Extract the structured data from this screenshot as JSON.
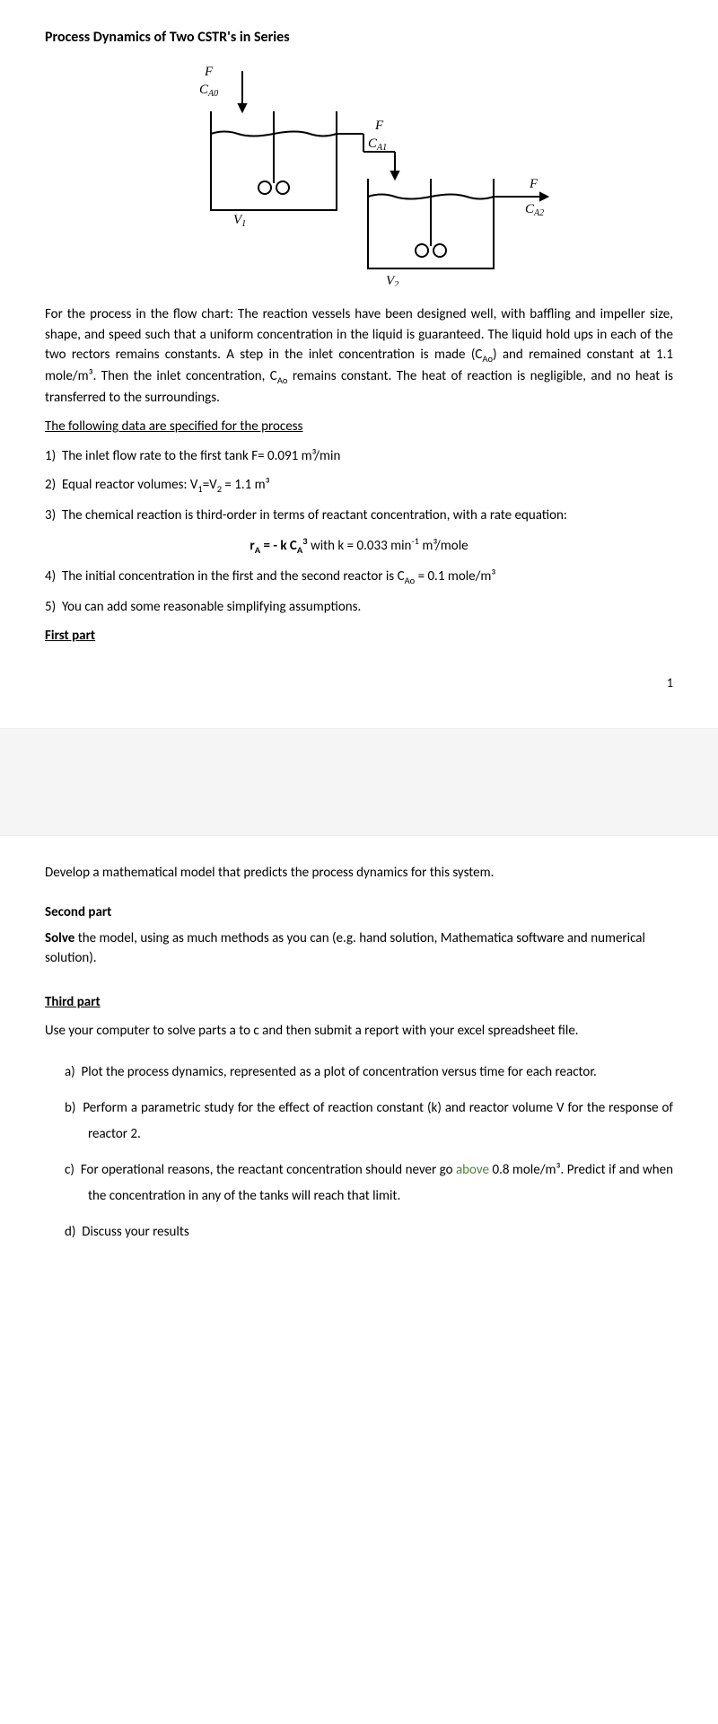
{
  "title": "Process Dynamics of Two CSTR's in Series",
  "diagram": {
    "inlet_F": "F",
    "inlet_C": "C",
    "inlet_C_sub": "A0",
    "tank1_V": "V",
    "tank1_V_sub": "1",
    "mid_F": "F",
    "mid_C": "C",
    "mid_C_sub": "A1",
    "tank2_V": "V",
    "tank2_V_sub": "2",
    "out_F": "F",
    "out_C": "C",
    "out_C_sub": "A2"
  },
  "intro_a": "For the process in the flow chart: The reaction vessels have been designed well, with baffling and impeller size, shape, and speed such that a uniform concentration in the liquid is guaranteed. The liquid hold ups in each of the two rectors remains constants. A step in the inlet concentration is made (C",
  "intro_a_sub": "Ao",
  "intro_b": ") and remained constant at 1.1 mole/m³. Then the inlet concentration, C",
  "intro_b_sub": "Ao",
  "intro_c": " remains constant. The heat of reaction is negligible, and no heat is transferred to the surroundings.",
  "spec_heading": "The following data are specified for the process",
  "spec": {
    "i1_n": "1)",
    "i1": "The inlet flow rate to the first tank F= 0.091 m³/min",
    "i2_n": "2)",
    "i2_a": "Equal reactor volumes: V",
    "i2_s1": "1",
    "i2_b": "=V",
    "i2_s2": "2",
    "i2_c": " = 1.1 m³",
    "i3_n": "3)",
    "i3": "The chemical reaction is third-order in terms of reactant concentration, with a rate equation:",
    "eq_a": "r",
    "eq_as": "A",
    "eq_b": " = - k C",
    "eq_bs": "A",
    "eq_bsup": "3",
    "eq_c": "  with k = 0.033 min",
    "eq_csup": "-1",
    "eq_d": " m³/mole",
    "i4_n": "4)",
    "i4_a": "The initial concentration in the first and the second reactor is C",
    "i4_s": "Ao",
    "i4_b": " = 0.1 mole/m³",
    "i5_n": "5)",
    "i5": "You can add some reasonable simplifying assumptions."
  },
  "first_part": "First part",
  "pagenum": "1",
  "p2": {
    "develop": "Develop a mathematical model that predicts the process dynamics for this system.",
    "second_h": "Second part",
    "second_a": "Solve",
    "second_b": " the model, using as much methods as you can (e.g. hand solution, Mathematica software and numerical solution).",
    "third_h": "Third part",
    "third_body": "Use your computer to solve parts a to c and then submit a report with your excel spreadsheet file.",
    "a_n": "a)",
    "a": "Plot the process dynamics, represented as a plot of concentration versus time for each reactor.",
    "b_n": "b)",
    "b": "Perform a parametric study for the effect of reaction constant (k) and reactor volume V for the response of reactor 2.",
    "c_n": "c)",
    "c_a": "For operational reasons, the reactant concentration should never go ",
    "c_green": "above",
    "c_b": " 0.8 mole/m³.  Predict if and when the concentration in any of the tanks will reach that limit.",
    "d_n": "d)",
    "d": "Discuss your results"
  }
}
